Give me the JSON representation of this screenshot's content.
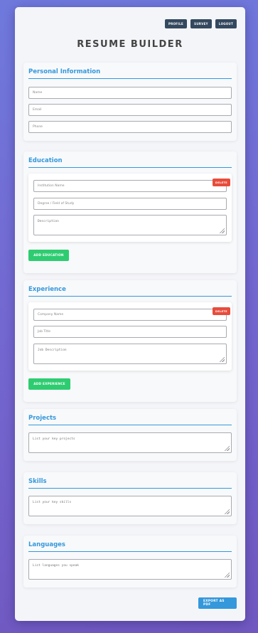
{
  "nav": {
    "profile": "PROFILE",
    "survey": "SURVEY",
    "logout": "LOGOUT"
  },
  "title": "RESUME BUILDER",
  "personal": {
    "heading": "Personal Information",
    "name_placeholder": "Name",
    "email_placeholder": "Email",
    "phone_placeholder": "Phone"
  },
  "education": {
    "heading": "Education",
    "institution_placeholder": "Institution Name",
    "degree_placeholder": "Degree / Field of Study",
    "description_placeholder": "Description",
    "delete_label": "DELETE",
    "add_label": "ADD EDUCATION"
  },
  "experience": {
    "heading": "Experience",
    "company_placeholder": "Company Name",
    "job_title_placeholder": "Job Title",
    "job_description_placeholder": "Job Description",
    "delete_label": "DELETE",
    "add_label": "ADD EXPERIENCE"
  },
  "projects": {
    "heading": "Projects",
    "placeholder": "List your key projects"
  },
  "skills": {
    "heading": "Skills",
    "placeholder": "List your key skills"
  },
  "languages": {
    "heading": "Languages",
    "placeholder": "List languages you speak"
  },
  "export_label": "EXPORT AS PDF",
  "colors": {
    "accent": "#3498db",
    "add_button": "#2ecc71",
    "delete_button": "#e74c3c",
    "nav_button": "#34495e"
  }
}
